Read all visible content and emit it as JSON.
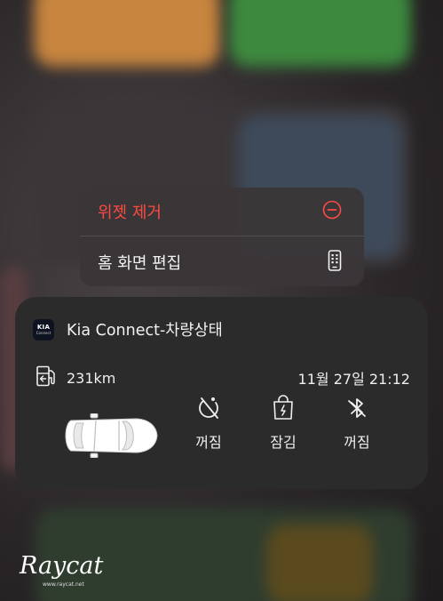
{
  "context_menu": {
    "remove_widget": "위젯 제거",
    "edit_home_screen": "홈 화면 편집"
  },
  "widget": {
    "app_icon_logo": "KIA",
    "app_icon_sub": "Connect",
    "app_title": "Kia Connect-차량상태",
    "range": "231km",
    "timestamp": "11월 27일 21:12",
    "statuses": [
      {
        "icon": "climate-off-icon",
        "label": "꺼짐"
      },
      {
        "icon": "door-lock-icon",
        "label": "잠김"
      },
      {
        "icon": "bluetooth-off-icon",
        "label": "꺼짐"
      }
    ]
  },
  "watermark": {
    "text": "Raycat",
    "sub": "www.raycat.net"
  },
  "colors": {
    "destructive": "#ff4a43",
    "card_bg": "#2b2b2c",
    "menu_bg": "#3a3638"
  }
}
